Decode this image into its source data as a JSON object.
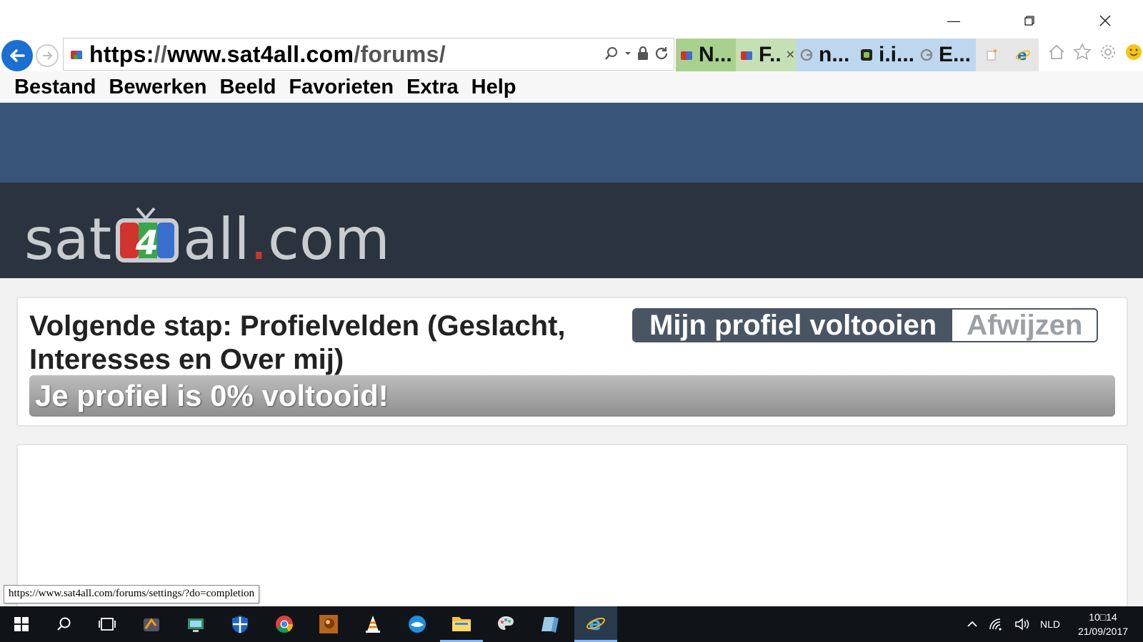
{
  "browser": {
    "address": {
      "prefix": "https:",
      "slashes": "//",
      "host": "www.sat4all.com",
      "path": "/forums/"
    },
    "tabs": [
      {
        "label": "N...",
        "active": false
      },
      {
        "label": "F..",
        "active": true
      },
      {
        "label": "n...",
        "active": false
      },
      {
        "label": "i.i...",
        "active": false
      },
      {
        "label": "E...",
        "active": false
      }
    ],
    "menu": [
      "Bestand",
      "Bewerken",
      "Beeld",
      "Favorieten",
      "Extra",
      "Help"
    ]
  },
  "site": {
    "logo": {
      "part1": "sat",
      "part2": "all",
      "dot": ".",
      "part3": "com"
    }
  },
  "completion": {
    "step_text": "Volgende stap: Profielvelden (Geslacht, Interesses en Over mij)",
    "primary_button": "Mijn profiel voltooien",
    "secondary_button": "Afwijzen",
    "progress_text": "Je profiel is 0% voltooid!",
    "progress_percent": 0
  },
  "status_bar": {
    "link": "https://www.sat4all.com/forums/settings/?do=completion"
  },
  "taskbar": {
    "language": "NLD",
    "time": "10□14",
    "date": "21/09/2017"
  },
  "colors": {
    "header_blue": "#385579",
    "logo_band": "#2b343e",
    "button_dark": "#4a5564",
    "taskbar": "#101419"
  }
}
